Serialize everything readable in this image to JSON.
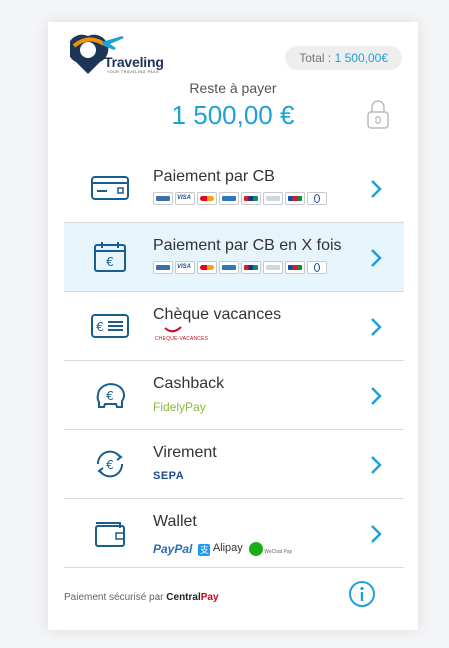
{
  "header": {
    "logo_text": "Traveling",
    "logo_tagline": "YOUR TRAVELING PASS",
    "total_label": "Total :",
    "total_value": "1 500,00€"
  },
  "summary": {
    "due_label": "Reste à payer",
    "due_amount": "1 500,00 €"
  },
  "payment_methods": [
    {
      "label": "Paiement par CB"
    },
    {
      "label": "Paiement par CB en X fois"
    },
    {
      "label": "Chèque vacances",
      "brand": "CHEQUE-VACANCES"
    },
    {
      "label": "Cashback",
      "brand": "FidelyPay"
    },
    {
      "label": "Virement",
      "brand": "SEPA"
    },
    {
      "label": "Wallet",
      "brands": [
        "PayPal",
        "Alipay",
        "WeChat Pay"
      ]
    }
  ],
  "card_brands": [
    "CB",
    "VISA",
    "Mastercard",
    "Amex",
    "UnionPay",
    "Carte",
    "JCB",
    "Diners"
  ],
  "footer": {
    "secure_text": "Paiement sécurisé par",
    "provider_main": "Central",
    "provider_accent": "Pay"
  },
  "colors": {
    "accent": "#1fa1d8",
    "active_row": "#e6f4fb",
    "logo_orange": "#f39200"
  }
}
